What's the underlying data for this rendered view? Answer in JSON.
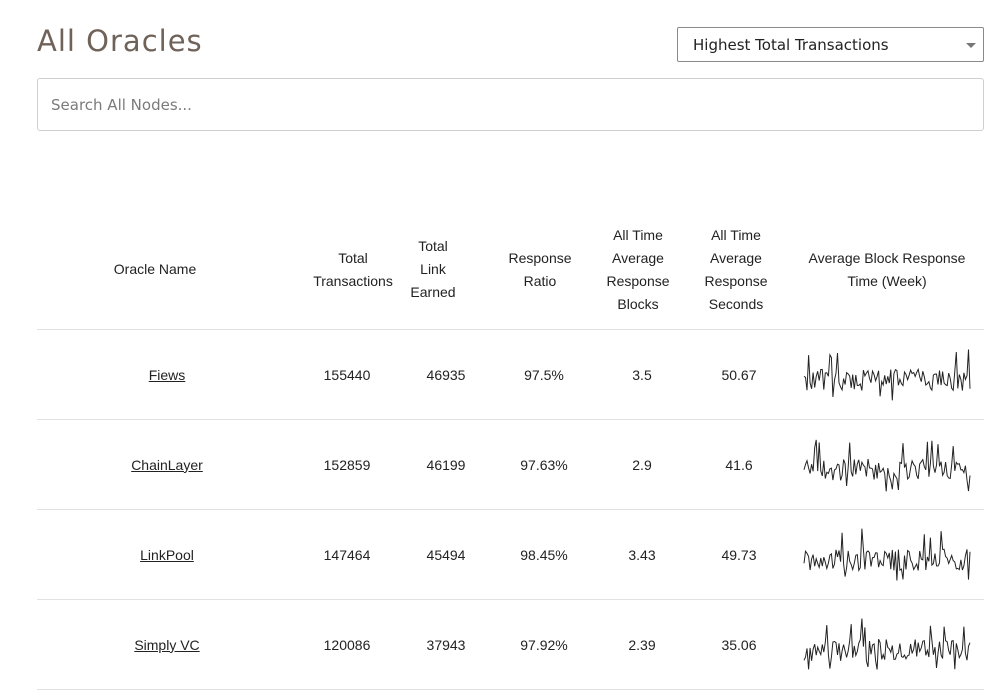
{
  "header": {
    "title": "All Oracles",
    "sort_selected": "Highest Total Transactions"
  },
  "search": {
    "placeholder": "Search All Nodes..."
  },
  "table": {
    "columns": [
      [
        "Oracle Name"
      ],
      [
        "Total",
        "Transactions"
      ],
      [
        "Total",
        "Link",
        "Earned"
      ],
      [
        "Response",
        "Ratio"
      ],
      [
        "All Time",
        "Average",
        "Response",
        "Blocks"
      ],
      [
        "All Time",
        "Average",
        "Response",
        "Seconds"
      ],
      [
        "Average Block Response",
        "Time (Week)"
      ]
    ],
    "rows": [
      {
        "name": "Fiews",
        "total_transactions": "155440",
        "link_earned": "46935",
        "response_ratio": "97.5%",
        "avg_blocks": "3.5",
        "avg_seconds": "50.67"
      },
      {
        "name": "ChainLayer",
        "total_transactions": "152859",
        "link_earned": "46199",
        "response_ratio": "97.63%",
        "avg_blocks": "2.9",
        "avg_seconds": "41.6"
      },
      {
        "name": "LinkPool",
        "total_transactions": "147464",
        "link_earned": "45494",
        "response_ratio": "98.45%",
        "avg_blocks": "3.43",
        "avg_seconds": "49.73"
      },
      {
        "name": "Simply VC",
        "total_transactions": "120086",
        "link_earned": "37943",
        "response_ratio": "97.92%",
        "avg_blocks": "2.39",
        "avg_seconds": "35.06"
      }
    ]
  }
}
